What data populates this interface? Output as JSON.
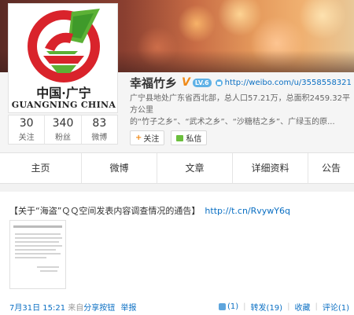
{
  "profile": {
    "name": "幸福竹乡",
    "verified_mark": "V",
    "level_badge": "LV.6",
    "url": "http://weibo.com/u/3558558321",
    "bio_line1": "广宁县地处广东省西北部，总人口57.21万，总面积2459.32平方公里",
    "bio_line2": "的“竹子之乡”、“武术之乡”、“沙糖桔之乡”、广绿玉的原...",
    "logo_cn": "中国·广宁",
    "logo_en": "GUANGNING CHINA",
    "logo_colors": {
      "ring": "#d9232b",
      "leaf": "#5cb135",
      "inner": "#ffffff"
    }
  },
  "stats": [
    {
      "count": "30",
      "label": "关注"
    },
    {
      "count": "340",
      "label": "粉丝"
    },
    {
      "count": "83",
      "label": "微博"
    }
  ],
  "actions": {
    "follow": "关注",
    "follow_icon": "+",
    "message": "私信"
  },
  "tabs": [
    "主页",
    "微博",
    "文章",
    "详细资料",
    "公告"
  ],
  "post": {
    "text": "【关于“海盗”ＱＱ空间发表内容调查情况的通告】",
    "link": "http://t.cn/RvywY6q",
    "time": "7月31日 15:21",
    "source_prefix": "来自",
    "source": "分享按钮",
    "report": "举报",
    "likes": "(1)",
    "repost": "转发(19)",
    "favorite": "收藏",
    "comment": "评论(1)"
  }
}
